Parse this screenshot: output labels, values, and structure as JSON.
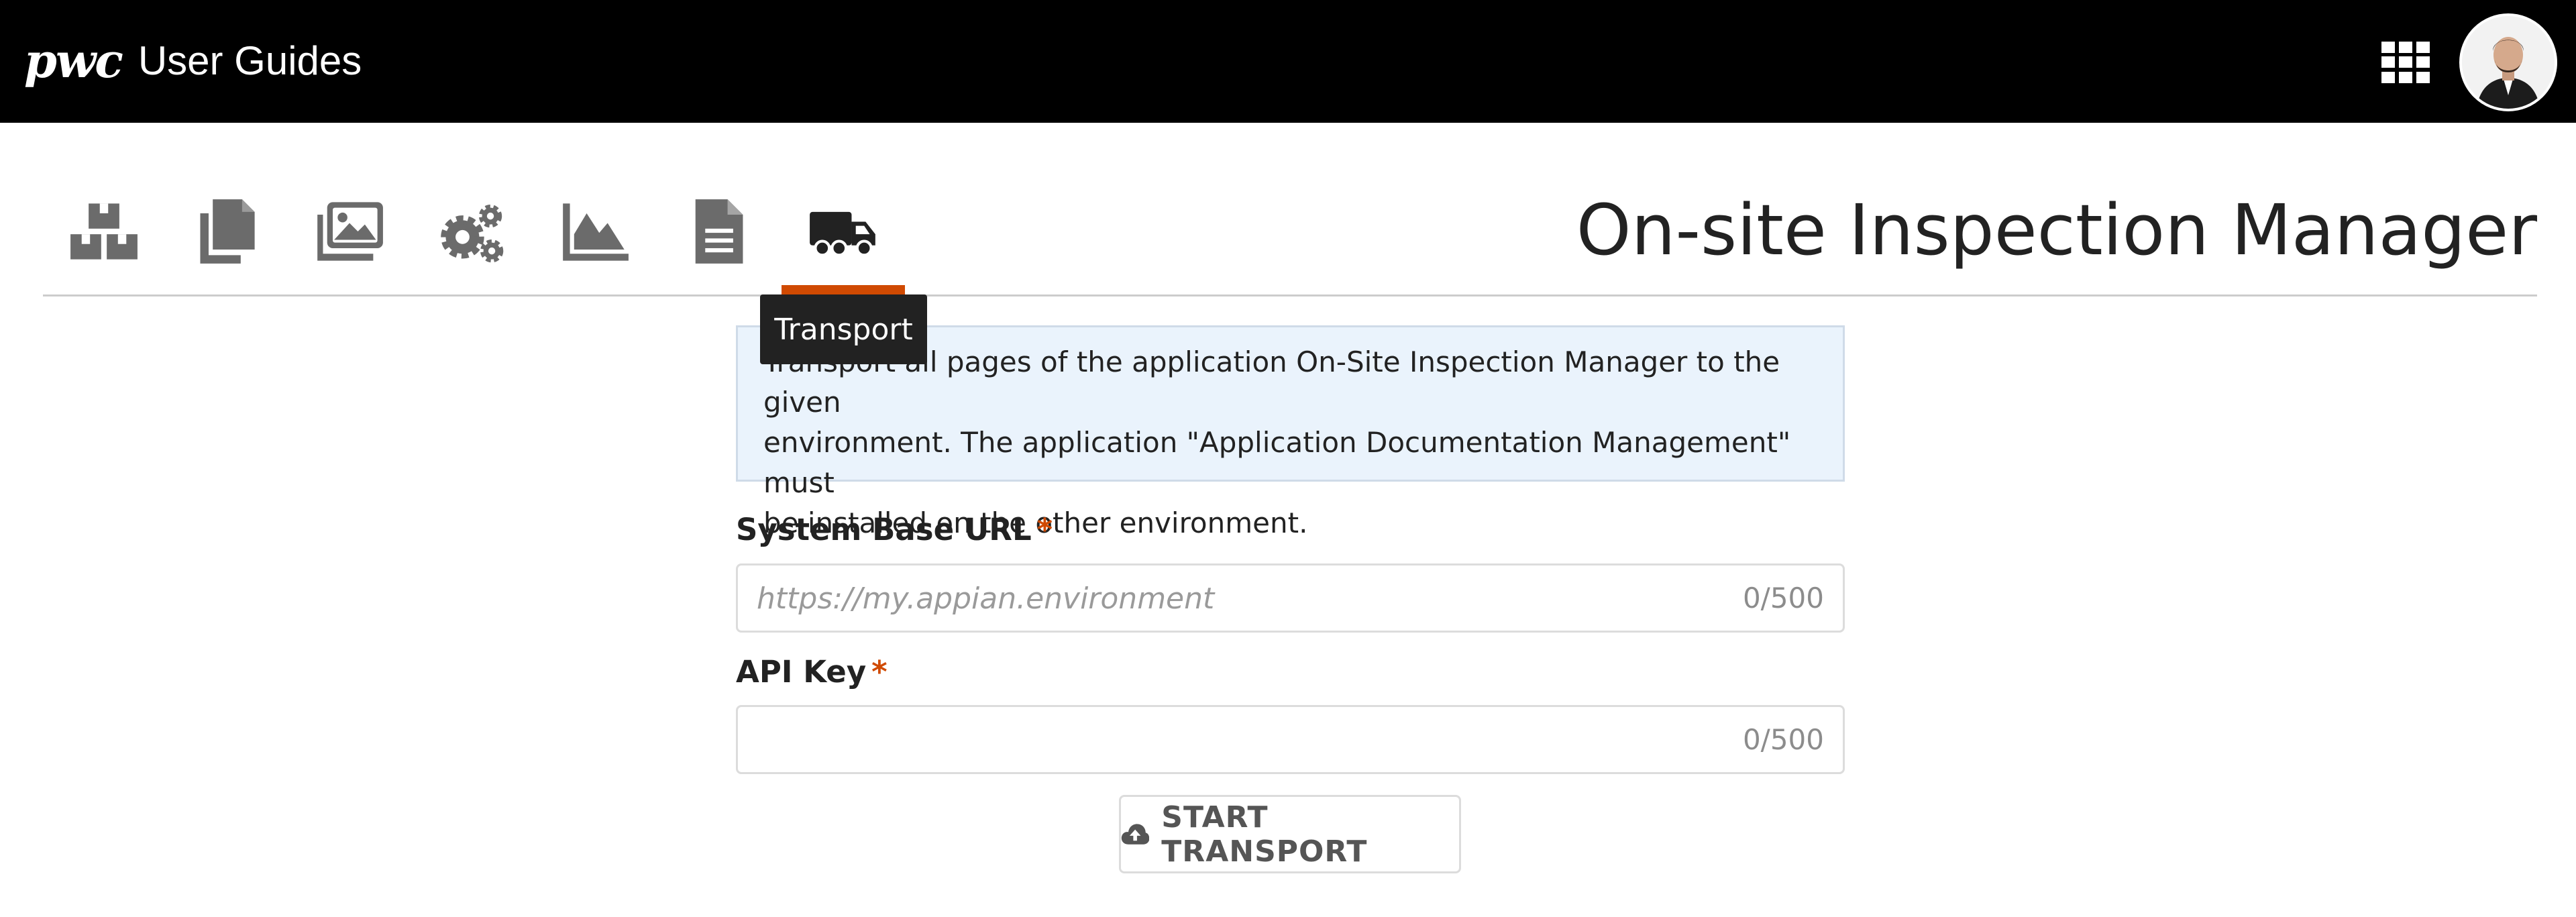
{
  "header": {
    "logo_text": "pwc",
    "app_title": "User Guides",
    "apps_icon": "grid-icon",
    "avatar_icon": "user-avatar"
  },
  "nav": {
    "tabs": [
      {
        "icon": "boxes-icon",
        "active": false
      },
      {
        "icon": "copy-icon",
        "active": false
      },
      {
        "icon": "images-icon",
        "active": false
      },
      {
        "icon": "gears-icon",
        "active": false
      },
      {
        "icon": "area-chart-icon",
        "active": false
      },
      {
        "icon": "document-icon",
        "active": false
      },
      {
        "icon": "truck-icon",
        "active": true
      }
    ],
    "active_color": "#d04a02",
    "tooltip": "Transport"
  },
  "page": {
    "title": "On-site Inspection Manager"
  },
  "info_box": {
    "line1": "Transport all pages of the application On-Site Inspection Manager to the given",
    "line2": "environment. The application \"Application Documentation Management\" must",
    "line3": "be installed on the other environment."
  },
  "form": {
    "system_base_url": {
      "label": "System Base URL",
      "required_mark": "*",
      "placeholder": "https://my.appian.environment",
      "value": "",
      "counter": "0/500"
    },
    "api_key": {
      "label": "API Key",
      "required_mark": "*",
      "placeholder": "",
      "value": "",
      "counter": "0/500"
    },
    "start_button": {
      "label": "START TRANSPORT",
      "icon": "cloud-upload-icon"
    }
  },
  "colors": {
    "header_bg": "#000000",
    "accent": "#d04a02",
    "icon_gray": "#6b6b6b",
    "info_bg": "#eaf3fc"
  }
}
